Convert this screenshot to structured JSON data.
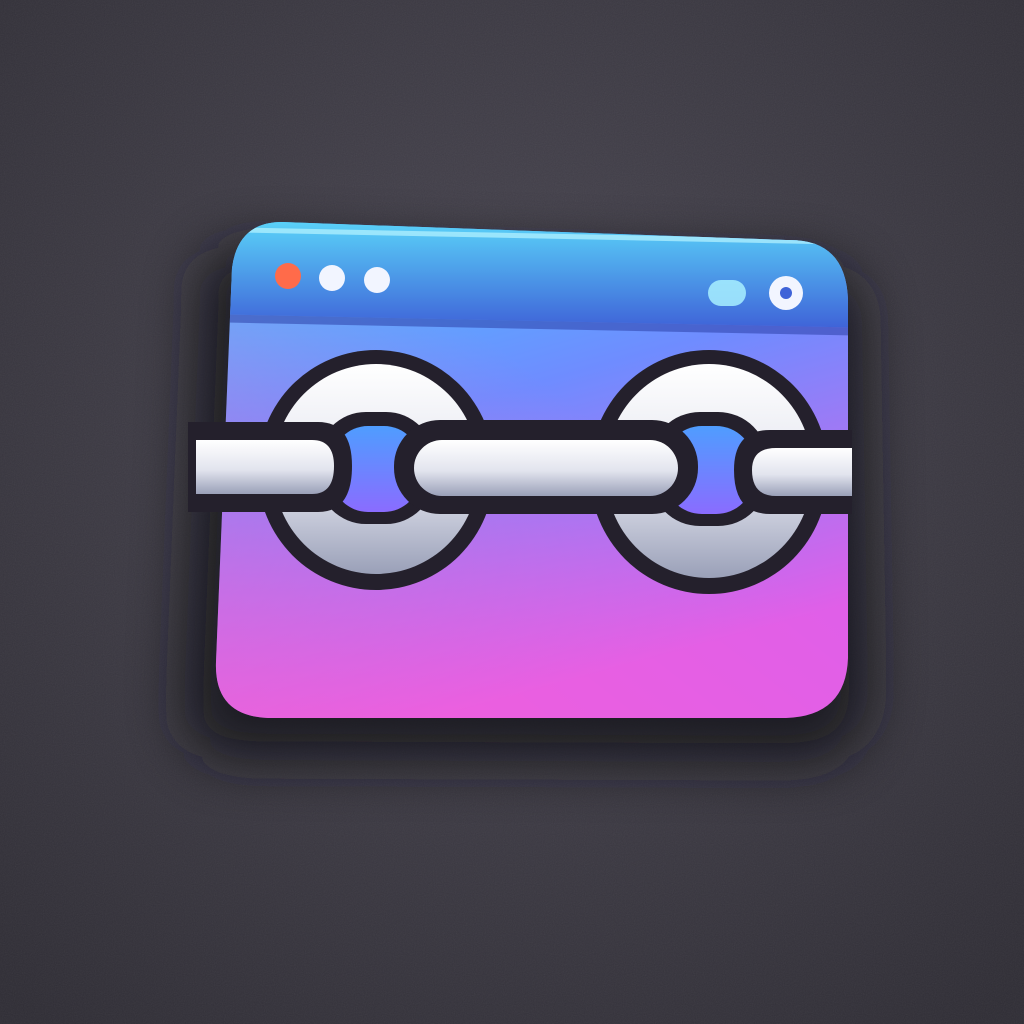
{
  "scene": {
    "subject": "browser-window-chain-link-icon",
    "colors": {
      "background": "#3f3c45",
      "background_dark": "#2f2d35",
      "window_top": "#4fd6ff",
      "window_mid": "#6f8cff",
      "window_bottom": "#e05fe8",
      "title_bar_top": "#5fe8ff",
      "title_bar_bottom": "#3f63d8",
      "chain_fill_light": "#f4f5fb",
      "chain_fill_shadow": "#9aa0b8",
      "chain_outline": "#24202c",
      "dot_red": "#ff6b4a",
      "dot_white": "#f2f5ff"
    },
    "window_controls": [
      {
        "name": "close",
        "color": "#ff6b4a"
      },
      {
        "name": "minimize",
        "color": "#f2f5ff"
      },
      {
        "name": "maximize",
        "color": "#f2f5ff"
      }
    ],
    "toolbar_icons": [
      "pill-icon",
      "circle-icon"
    ],
    "chain_icon": "chain-link-icon"
  }
}
